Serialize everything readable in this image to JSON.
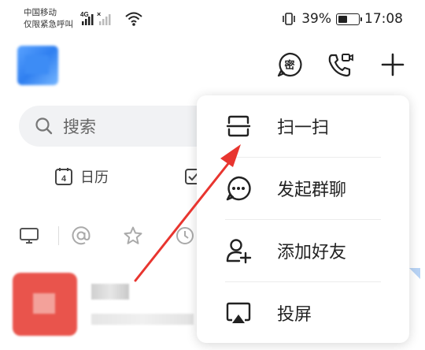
{
  "status_bar": {
    "carrier_line1": "中国移动",
    "carrier_line2": "仅限紧急呼叫",
    "network_type": "4G",
    "battery_percent": "39%",
    "time": "17:08"
  },
  "header": {
    "icons": [
      "mini-program-icon",
      "video-call-icon",
      "add-icon"
    ],
    "mini_program_glyph": "密"
  },
  "search": {
    "placeholder": "搜索"
  },
  "quick_actions": [
    {
      "icon": "calendar-icon",
      "icon_text": "4",
      "label": "日历"
    },
    {
      "icon": "checkbox-icon",
      "label": ""
    }
  ],
  "filter_icons": [
    "monitor-icon",
    "at-icon",
    "star-icon",
    "clock-icon"
  ],
  "popup_menu": {
    "items": [
      {
        "label": "扫一扫",
        "icon": "scan-icon"
      },
      {
        "label": "发起群聊",
        "icon": "group-chat-icon"
      },
      {
        "label": "添加好友",
        "icon": "add-friend-icon"
      },
      {
        "label": "投屏",
        "icon": "screen-cast-icon"
      }
    ]
  },
  "annotation": {
    "color": "#e8352f"
  },
  "colors": {
    "avatar_blue": "#3d8cf5",
    "chat_avatar_red": "#e9544c",
    "search_bg": "#f1f2f4"
  }
}
